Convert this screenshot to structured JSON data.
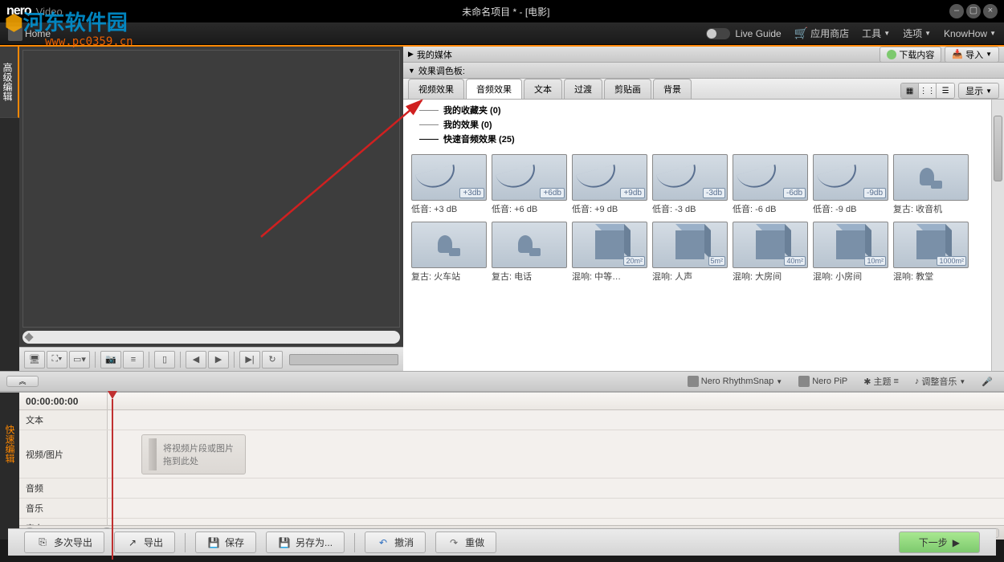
{
  "titlebar": {
    "logo": "nero",
    "app_name": "Video",
    "project_title": "未命名项目 * - [电影]"
  },
  "menubar": {
    "home": "Home",
    "live_guide": "Live Guide",
    "app_store": "应用商店",
    "tools": "工具",
    "options": "选项",
    "knowhow": "KnowHow"
  },
  "sidebar": {
    "advanced_edit": "高级编辑",
    "quick_edit": "快速编辑"
  },
  "media_section": {
    "my_media": "我的媒体",
    "download": "下载内容",
    "import": "导入"
  },
  "palette": {
    "title": "效果调色板:",
    "tabs": {
      "video_fx": "视频效果",
      "audio_fx": "音频效果",
      "text": "文本",
      "transition": "过渡",
      "clipart": "剪贴画",
      "background": "背景"
    },
    "view_label": "显示",
    "tree": {
      "favorites": "我的收藏夹 (0)",
      "my_effects": "我的效果 (0)",
      "quick_audio": "快速音频效果 (25)"
    },
    "effects": [
      {
        "label": "低音: +3 dB",
        "badge": "+3db",
        "type": "wave"
      },
      {
        "label": "低音: +6 dB",
        "badge": "+6db",
        "type": "wave"
      },
      {
        "label": "低音: +9 dB",
        "badge": "+9db",
        "type": "wave"
      },
      {
        "label": "低音: -3 dB",
        "badge": "-3db",
        "type": "wave"
      },
      {
        "label": "低音: -6 dB",
        "badge": "-6db",
        "type": "wave"
      },
      {
        "label": "低音: -9 dB",
        "badge": "-9db",
        "type": "wave"
      },
      {
        "label": "复古: 收音机",
        "badge": "",
        "type": "horn"
      },
      {
        "label": "复古: 火车站",
        "badge": "",
        "type": "horn"
      },
      {
        "label": "复古: 电话",
        "badge": "",
        "type": "horn"
      },
      {
        "label": "混响: 中等…",
        "badge": "20m²",
        "type": "cube"
      },
      {
        "label": "混响: 人声",
        "badge": "5m²",
        "type": "cube"
      },
      {
        "label": "混响: 大房间",
        "badge": "40m²",
        "type": "cube"
      },
      {
        "label": "混响: 小房间",
        "badge": "10m²",
        "type": "cube"
      },
      {
        "label": "混响: 教堂",
        "badge": "1000m²",
        "type": "cube"
      }
    ]
  },
  "midbar": {
    "rhythm_snap": "Nero RhythmSnap",
    "nero_pip": "Nero PiP",
    "theme": "主题",
    "adjust_music": "调整音乐"
  },
  "timeline": {
    "time": "00:00:00:00",
    "tracks": {
      "text": "文本",
      "video": "视频/图片",
      "audio": "音频",
      "music": "音乐",
      "narration": "旁白"
    },
    "drop_hint": "将视频片段或图片拖到此处"
  },
  "bottom": {
    "multi_export": "多次导出",
    "export": "导出",
    "save": "保存",
    "save_as": "另存为...",
    "undo": "撤消",
    "redo": "重做",
    "next": "下一步"
  },
  "watermark": {
    "text": "河东软件园",
    "url": "www.pc0359.cn"
  }
}
